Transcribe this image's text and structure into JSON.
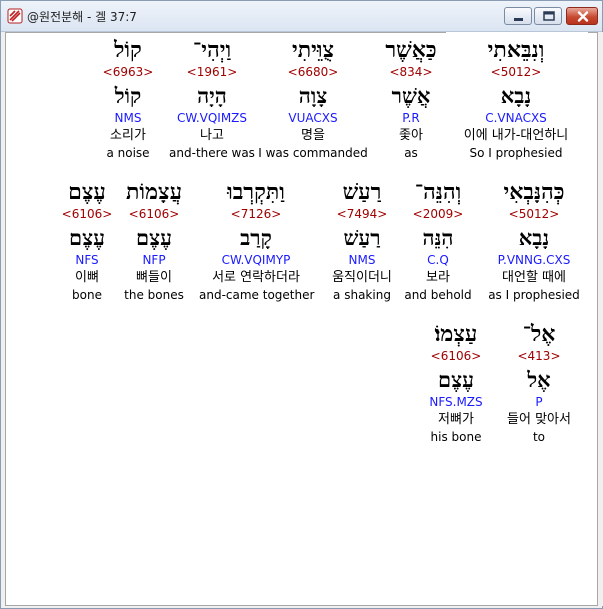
{
  "window": {
    "title": "@원전분해 - 겔 37:7",
    "app_icon": "hebrew-analysis-app-icon",
    "controls": [
      "minimize-icon",
      "maximize-icon",
      "close-icon"
    ],
    "close_color": "#c74b33"
  },
  "colors": {
    "strong": "#a00000",
    "parse": "#1a1aff",
    "text": "#000000"
  },
  "rows": [
    [
      {
        "heb": "וְנִבֵּאתִי",
        "strong": "<5012>",
        "lemma": "נָבָא",
        "parse": "C.VNACXS",
        "korean": "이에 내가-대언하니",
        "english": "So I prophesied",
        "selected": true
      },
      {
        "heb": "כַּאֲשֶׁר",
        "strong": "<834>",
        "lemma": "אֲשֶׁר",
        "parse": "P.R",
        "korean": "좇아",
        "english": "as"
      },
      {
        "heb": "צֻוֵּיתִי",
        "strong": "<6680>",
        "lemma": "צָוָה",
        "parse": "VUACXS",
        "korean": "명을",
        "english": "I was commanded"
      },
      {
        "heb": "וַיְהִי־",
        "strong": "<1961>",
        "lemma": "הָיָה",
        "parse": "CW.VQIMZS",
        "korean": "나고",
        "english": "and-there was"
      },
      {
        "heb": "קוֹל",
        "strong": "<6963>",
        "lemma": "קוֹל",
        "parse": "NMS",
        "korean": "소리가",
        "english": "a noise"
      }
    ],
    [
      {
        "heb": "כְּהִנָּבְאִי",
        "strong": "<5012>",
        "lemma": "נָבָא",
        "parse": "P.VNNG.CXS",
        "korean": "대언할 때에",
        "english": "as I prophesied"
      },
      {
        "heb": "וְהִנֵּה־",
        "strong": "<2009>",
        "lemma": "הִנֵּה",
        "parse": "C.Q",
        "korean": "보라",
        "english": "and behold"
      },
      {
        "heb": "רַעַשׁ",
        "strong": "<7494>",
        "lemma": "רַעַשׁ",
        "parse": "NMS",
        "korean": "움직이더니",
        "english": "a shaking"
      },
      {
        "heb": "וַתִּקְרְבוּ",
        "strong": "<7126>",
        "lemma": "קָרַב",
        "parse": "CW.VQIMYP",
        "korean": "서로 연락하더라",
        "english": "and-came together"
      },
      {
        "heb": "עֲצָמוֹת",
        "strong": "<6106>",
        "lemma": "עֶצֶם",
        "parse": "NFP",
        "korean": "뼈들이",
        "english": "the bones"
      },
      {
        "heb": "עֶצֶם",
        "strong": "<6106>",
        "lemma": "עֶצֶם",
        "parse": "NFS",
        "korean": "이뼈",
        "english": "bone"
      }
    ],
    [
      {
        "heb": "אֶל־",
        "strong": "<413>",
        "lemma": "אֶל",
        "parse": "P",
        "korean": "들어 맞아서",
        "english": "to"
      },
      {
        "heb": "עַצְמוֹ׃",
        "strong": "<6106>",
        "lemma": "עֶצֶם",
        "parse": "NFS.MZS",
        "korean": "저뼈가",
        "english": "his bone"
      }
    ]
  ]
}
